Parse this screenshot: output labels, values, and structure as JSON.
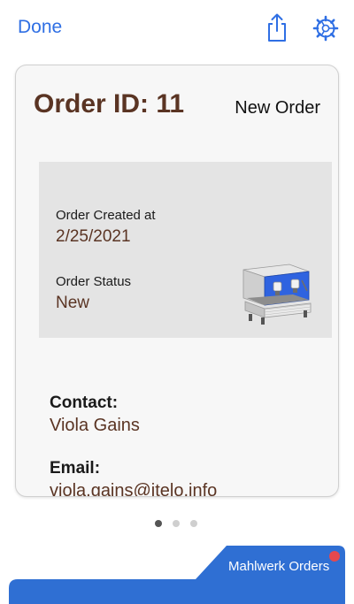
{
  "nav": {
    "done_label": "Done",
    "share_icon": "share-icon",
    "settings_icon": "gear-icon"
  },
  "card": {
    "title": "Order ID: 11",
    "badge": "New Order",
    "created_label": "Order Created at",
    "created_value": "2/25/2021",
    "status_label": "Order Status",
    "status_value": "New",
    "thumbnail": "espresso-machine-image",
    "contact_label": "Contact:",
    "contact_value": "Viola Gains",
    "email_label": "Email:",
    "email_value": "viola.gains@itelo.info"
  },
  "pager": {
    "current": 1,
    "total": 3
  },
  "stack": {
    "tab_label": "Mahlwerk Orders",
    "notification": true
  },
  "colors": {
    "accent": "#2f6fe4",
    "brown": "#5a3423",
    "tab_blue": "#2f6fd3",
    "notification_red": "#e5484d"
  }
}
